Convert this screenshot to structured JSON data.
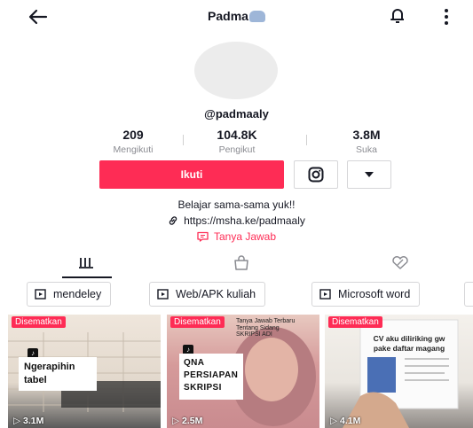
{
  "header": {
    "title": "Padma",
    "icons": [
      "back-arrow-icon",
      "bell-icon",
      "more-vertical-icon"
    ]
  },
  "profile": {
    "username": "@padmaaly",
    "bio": "Belajar sama-sama yuk!!",
    "link": "https://msha.ke/padmaaly",
    "qa_label": "Tanya Jawab"
  },
  "stats": [
    {
      "value": "209",
      "label": "Mengikuti"
    },
    {
      "value": "104.8K",
      "label": "Pengikut"
    },
    {
      "value": "3.8M",
      "label": "Suka"
    }
  ],
  "actions": {
    "follow_label": "Ikuti"
  },
  "tabs": [
    "grid-icon",
    "shop-bag-icon",
    "liked-icon"
  ],
  "playlists": [
    "mendeley",
    "Web/APK kuliah",
    "Microsoft word"
  ],
  "videos": [
    {
      "pinned": "Disematkan",
      "caption": "Ngerapihin\ntabel",
      "views": "3.1M"
    },
    {
      "pinned": "Disematkan",
      "top_text": "Tanya Jawab Terbaru Tentang Sidang\nSKRIPSI ADI",
      "caption": "QNA\nPERSIAPAN\nSKRIPSI",
      "views": "2.5M"
    },
    {
      "pinned": "Disematkan",
      "caption": "CV aku diliriking gw\npake daftar magang",
      "views": "4.1M"
    }
  ],
  "colors": {
    "accent": "#fe2c55",
    "text": "#161823",
    "muted": "#8a8b91"
  }
}
